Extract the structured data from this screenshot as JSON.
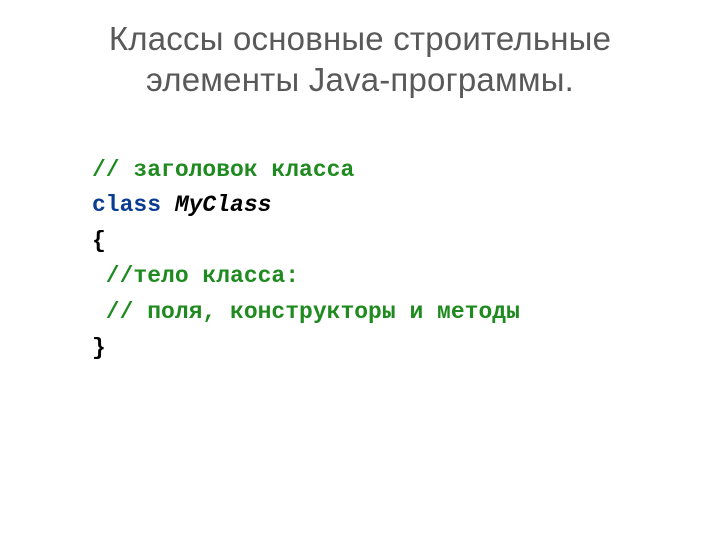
{
  "title": {
    "line1": "Классы основные строительные",
    "line2": "элементы Java-программы."
  },
  "code": {
    "line1_comment": "// заголовок класса",
    "line2_keyword": "class",
    "line2_space": " ",
    "line2_classname": "MyClass",
    "line3_brace": "{",
    "line4_comment": " //тело класса:",
    "line5_comment": " // поля, конструкторы и методы",
    "line6_brace": "}"
  }
}
